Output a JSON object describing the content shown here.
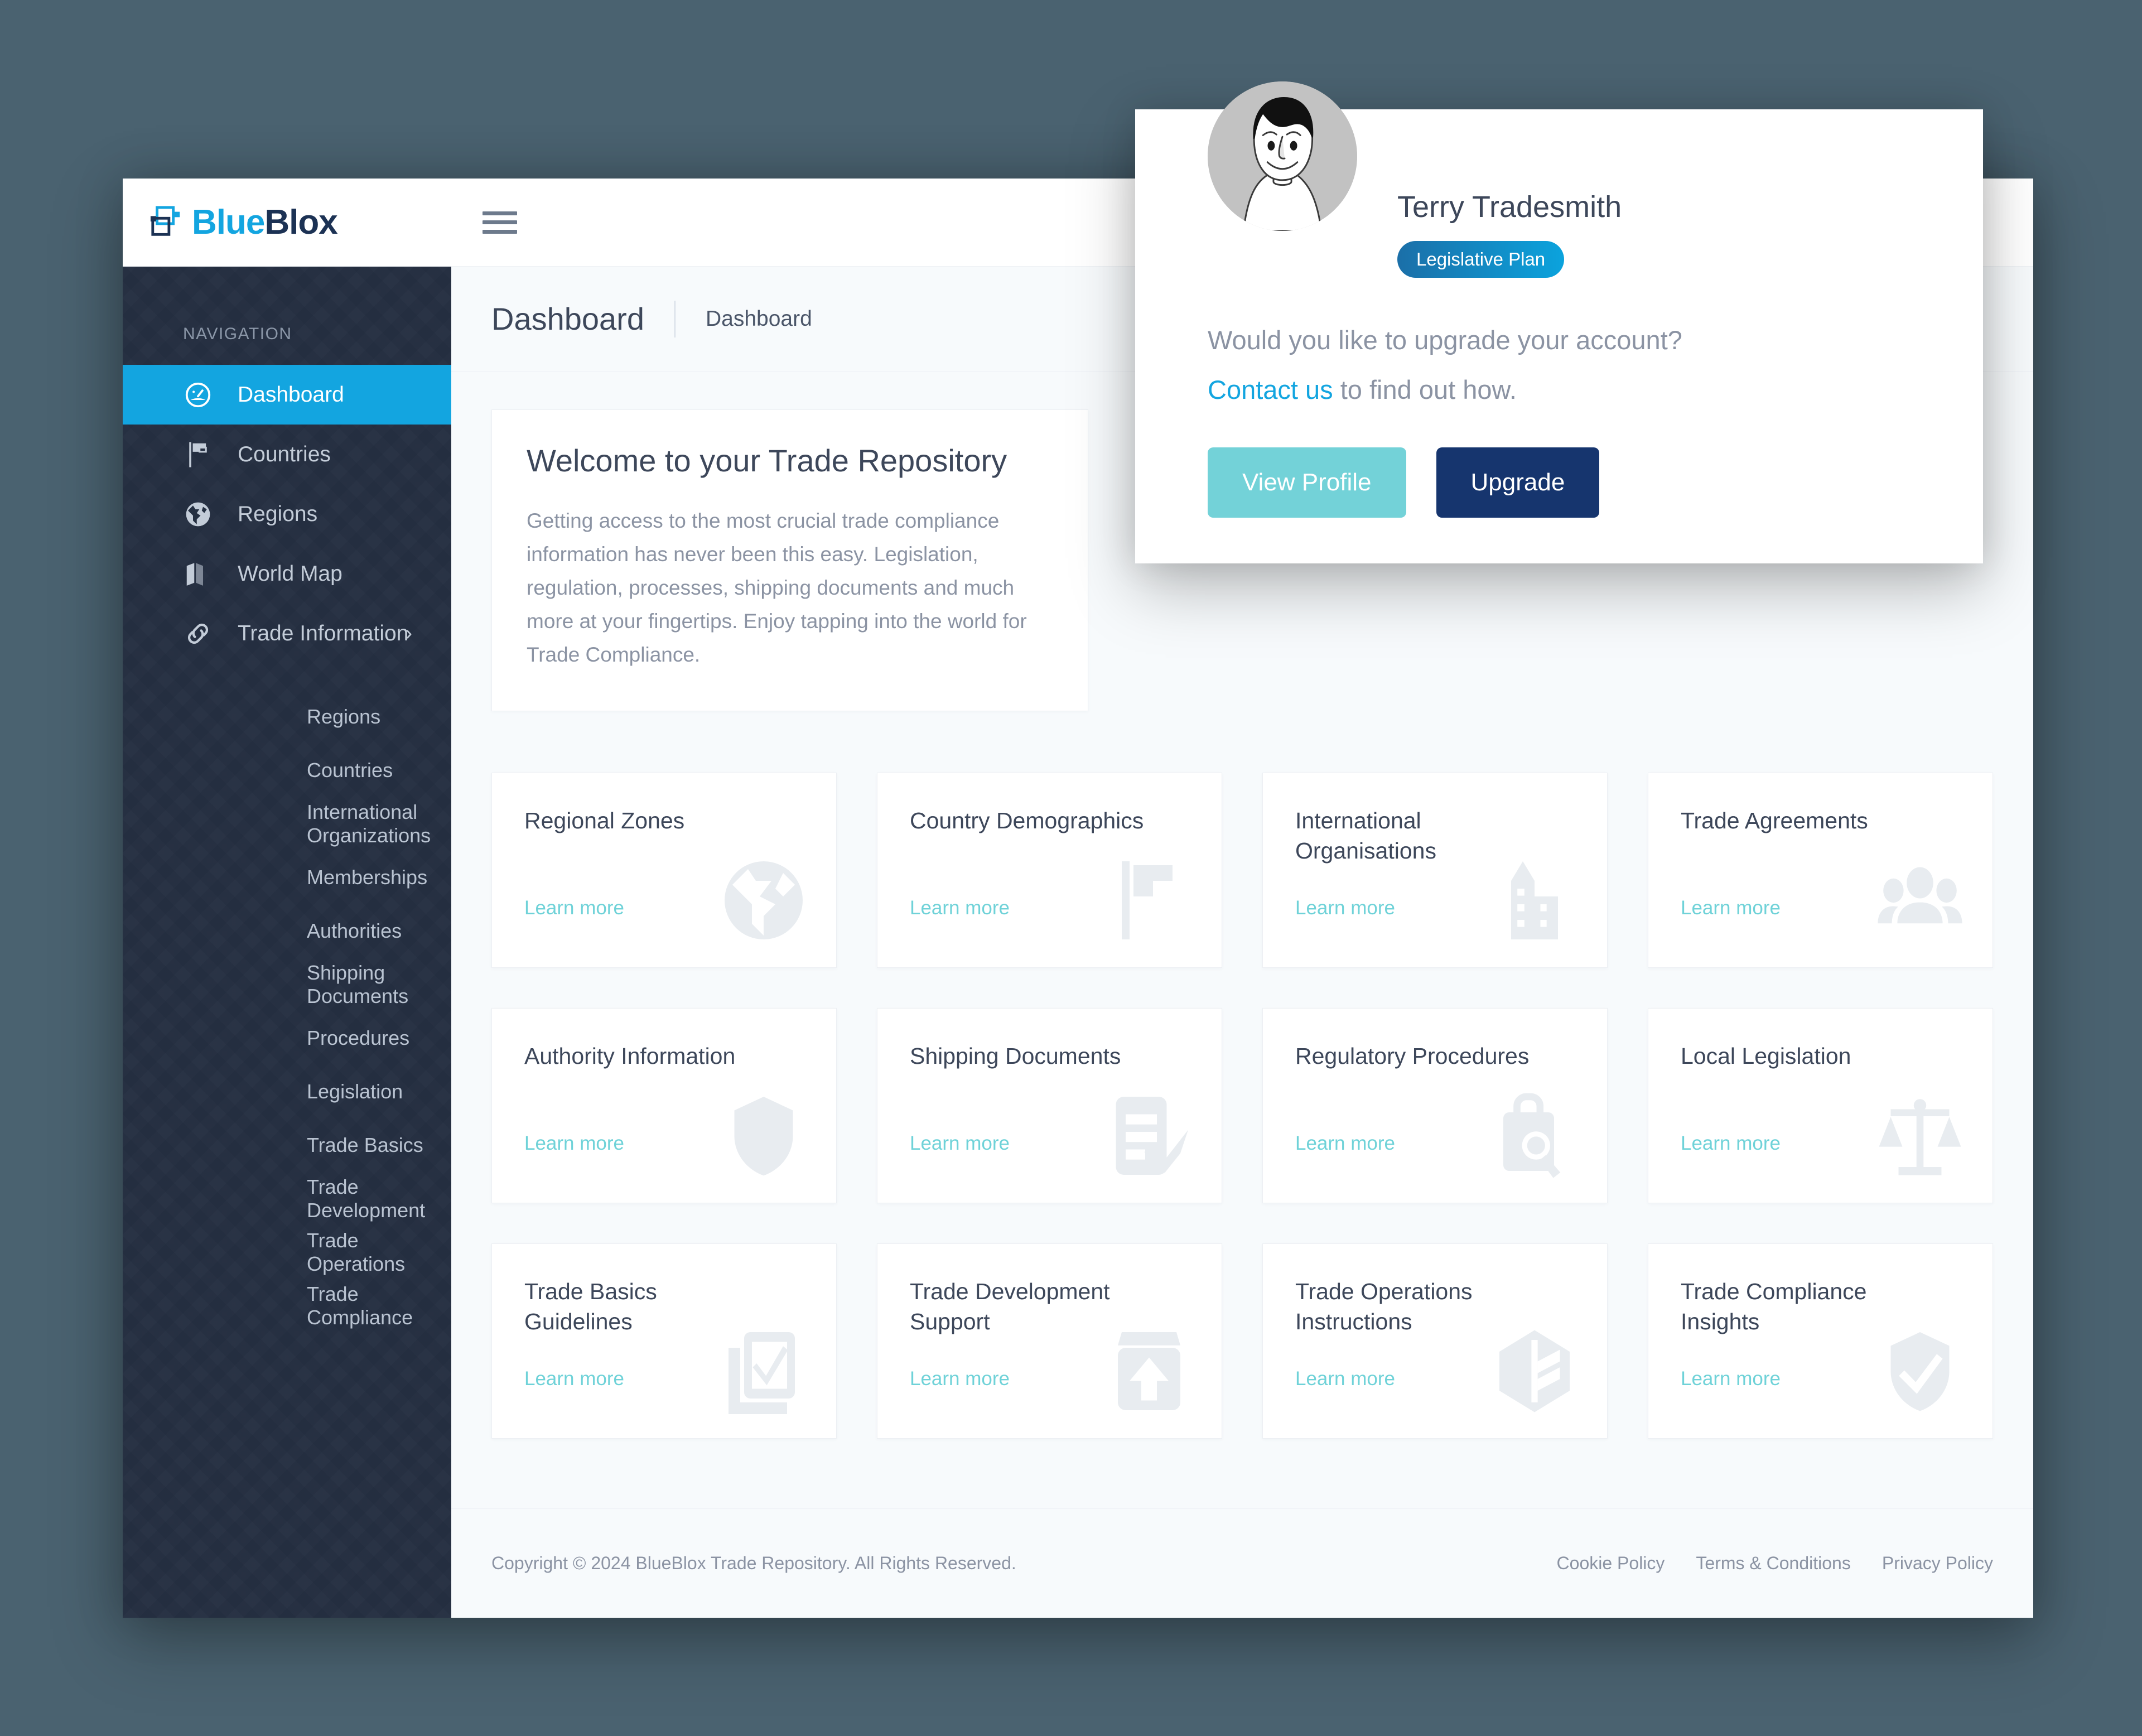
{
  "brand": {
    "logo_text_primary": "Blue",
    "logo_text_secondary": "Blox",
    "accent_blue": "#13a5e0",
    "dark_navy": "#1c3254",
    "teal": "#6fd2d8",
    "sidebar_bg": "#242f41",
    "page_bg": "#4a6270"
  },
  "topbar": {
    "menu_icon": "hamburger-icon"
  },
  "sidebar": {
    "section_label": "NAVIGATION",
    "items": [
      {
        "label": "Dashboard",
        "icon": "gauge-icon",
        "active": true,
        "has_chevron": false
      },
      {
        "label": "Countries",
        "icon": "flag-icon",
        "active": false,
        "has_chevron": false
      },
      {
        "label": "Regions",
        "icon": "globe-icon",
        "active": false,
        "has_chevron": false
      },
      {
        "label": "World Map",
        "icon": "map-icon",
        "active": false,
        "has_chevron": false
      },
      {
        "label": "Trade Information",
        "icon": "link-icon",
        "active": false,
        "has_chevron": true,
        "chevron": "›"
      }
    ],
    "subitems": [
      {
        "label": "Regions"
      },
      {
        "label": "Countries"
      },
      {
        "label": "International Organizations"
      },
      {
        "label": "Memberships"
      },
      {
        "label": "Authorities"
      },
      {
        "label": "Shipping Documents"
      },
      {
        "label": "Procedures"
      },
      {
        "label": "Legislation"
      },
      {
        "label": "Trade Basics"
      },
      {
        "label": "Trade Development"
      },
      {
        "label": "Trade Operations"
      },
      {
        "label": "Trade Compliance"
      }
    ]
  },
  "page": {
    "title": "Dashboard",
    "breadcrumb": "Dashboard"
  },
  "welcome": {
    "title": "Welcome to your Trade Repository",
    "body": "Getting access to the most crucial trade compliance information has never been this easy. Legislation, regulation, processes, shipping documents and much more at your fingertips. Enjoy tapping into the world for Trade Compliance."
  },
  "cards": {
    "learn_more_label": "Learn more",
    "items": [
      {
        "title": "Regional Zones",
        "icon": "globe-icon"
      },
      {
        "title": "Country Demographics",
        "icon": "flag-icon"
      },
      {
        "title": "International Organisations",
        "icon": "building-icon"
      },
      {
        "title": "Trade Agreements",
        "icon": "users-icon"
      },
      {
        "title": "Authority Information",
        "icon": "shield-icon"
      },
      {
        "title": "Shipping Documents",
        "icon": "document-check-icon"
      },
      {
        "title": "Regulatory Procedures",
        "icon": "briefcase-search-icon"
      },
      {
        "title": "Local Legislation",
        "icon": "scales-icon"
      },
      {
        "title": "Trade Basics Guidelines",
        "icon": "checkbox-card-icon"
      },
      {
        "title": "Trade Development Support",
        "icon": "upload-box-icon"
      },
      {
        "title": "Trade Operations Instructions",
        "icon": "cube-icon"
      },
      {
        "title": "Trade Compliance Insights",
        "icon": "shield-check-icon"
      }
    ]
  },
  "footer": {
    "copyright": "Copyright © 2024 BlueBlox Trade Repository. All Rights Reserved.",
    "links": [
      "Cookie Policy",
      "Terms & Conditions",
      "Privacy Policy"
    ]
  },
  "profile_popup": {
    "avatar_icon": "user-avatar-illustration",
    "name": "Terry Tradesmith",
    "plan_badge": "Legislative Plan",
    "question": "Would you like to upgrade your account?",
    "cta_link": "Contact us",
    "cta_rest": " to find out how.",
    "view_profile_label": "View Profile",
    "upgrade_label": "Upgrade"
  }
}
